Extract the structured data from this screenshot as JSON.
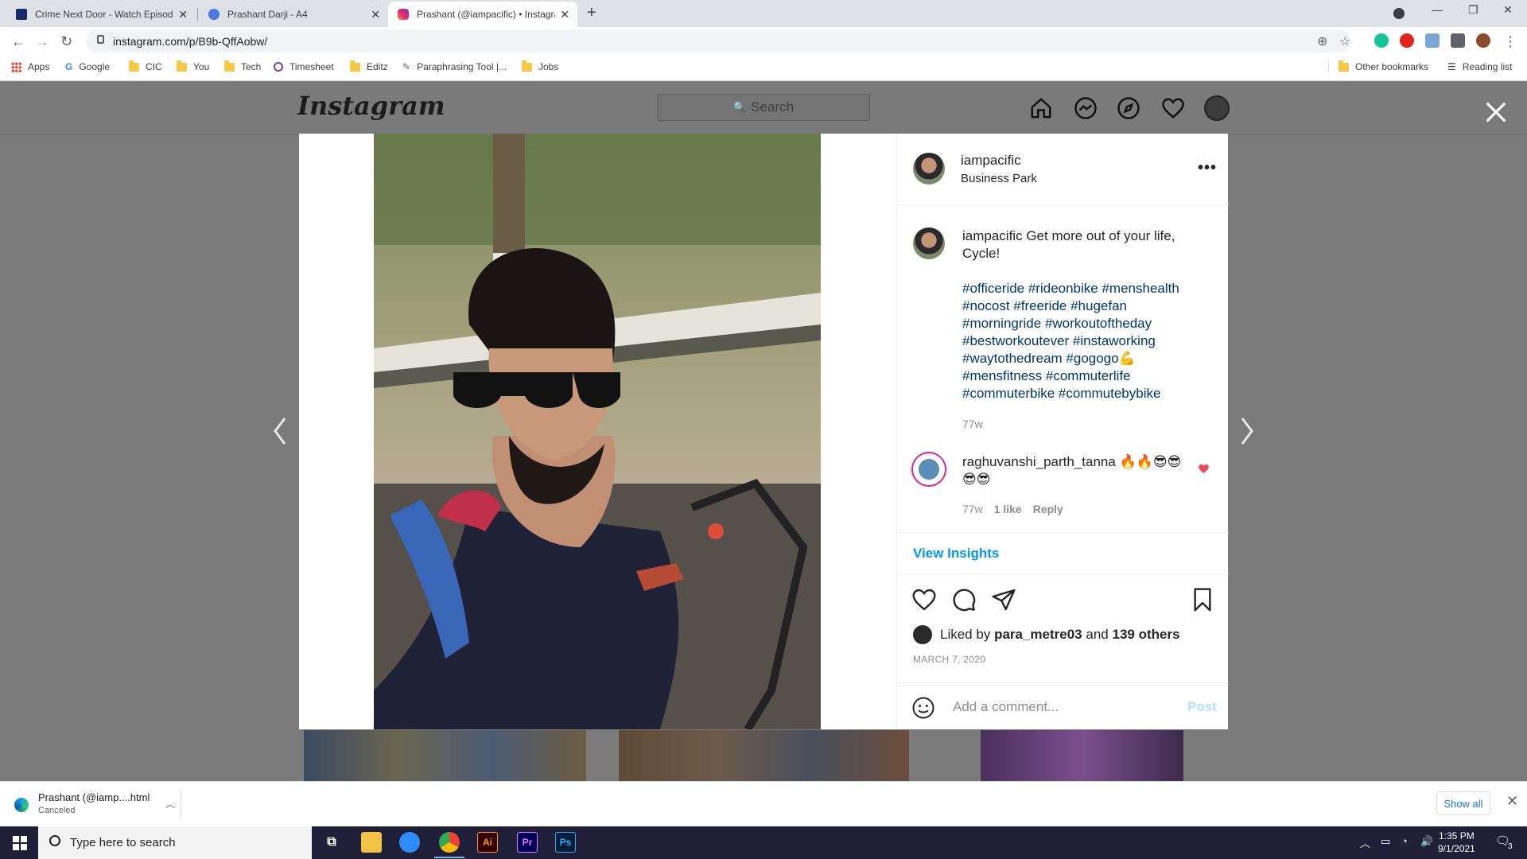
{
  "browser": {
    "tabs": [
      {
        "title": "Crime Next Door - Watch Episod",
        "close": "✕",
        "favicon_color": "#1a2a6c"
      },
      {
        "title": "Prashant Darji - A4",
        "close": "✕",
        "favicon_color": "#4a7be0"
      },
      {
        "title": "Prashant (@iampacific) • Instagra",
        "close": "✕",
        "favicon_color": "#d6249f"
      }
    ],
    "url": "instagram.com/p/B9b-QffAobw/",
    "bookmarks": [
      {
        "label": "Apps",
        "icon": "apps-grid-icon"
      },
      {
        "label": "Google",
        "icon": "google-g-icon"
      },
      {
        "label": "CIC",
        "icon": "folder-icon"
      },
      {
        "label": "You",
        "icon": "folder-icon"
      },
      {
        "label": "Tech",
        "icon": "folder-icon"
      },
      {
        "label": "Timesheet",
        "icon": "circle-icon"
      },
      {
        "label": "Editz",
        "icon": "folder-icon"
      },
      {
        "label": "Paraphrasing Tool |...",
        "icon": "pen-icon"
      },
      {
        "label": "Jobs",
        "icon": "folder-icon"
      }
    ],
    "other_bookmarks": "Other bookmarks",
    "reading_list": "Reading list"
  },
  "instagram": {
    "logo": "Instagram",
    "search_placeholder": "Search",
    "post": {
      "username": "iampacific",
      "location": "Business Park",
      "caption_user": "iampacific",
      "caption_text": "Get more out of your life, Cycle!",
      "hashtags": "#officeride #rideonbike #menshealth #nocost #freeride #hugefan #morningride #workoutoftheday #bestworkoutever #instaworking #waytothedream #gogogo💪 #mensfitness #commuterlife #commuterbike #commutebybike",
      "caption_time": "77w",
      "comment": {
        "user": "raghuvanshi_parth_tanna",
        "text": "🔥🔥😎😎😎😎",
        "time": "77w",
        "likes": "1 like",
        "reply": "Reply"
      },
      "view_insights": "View Insights",
      "liked_by_prefix": "Liked by",
      "liked_by_user": "para_metre03",
      "liked_by_and": "and",
      "liked_by_others": "139 others",
      "date": "MARCH 7, 2020",
      "add_comment_placeholder": "Add a comment...",
      "post_button": "Post"
    }
  },
  "download": {
    "filename": "Prashant (@iamp....html",
    "status": "Canceled",
    "show_all": "Show all"
  },
  "taskbar": {
    "search_placeholder": "Type here to search",
    "time": "1:35 PM",
    "date": "9/1/2021",
    "notifications": "3"
  },
  "colors": {
    "link": "#00376b",
    "accent": "#0095f6",
    "heart": "#ed4956"
  }
}
